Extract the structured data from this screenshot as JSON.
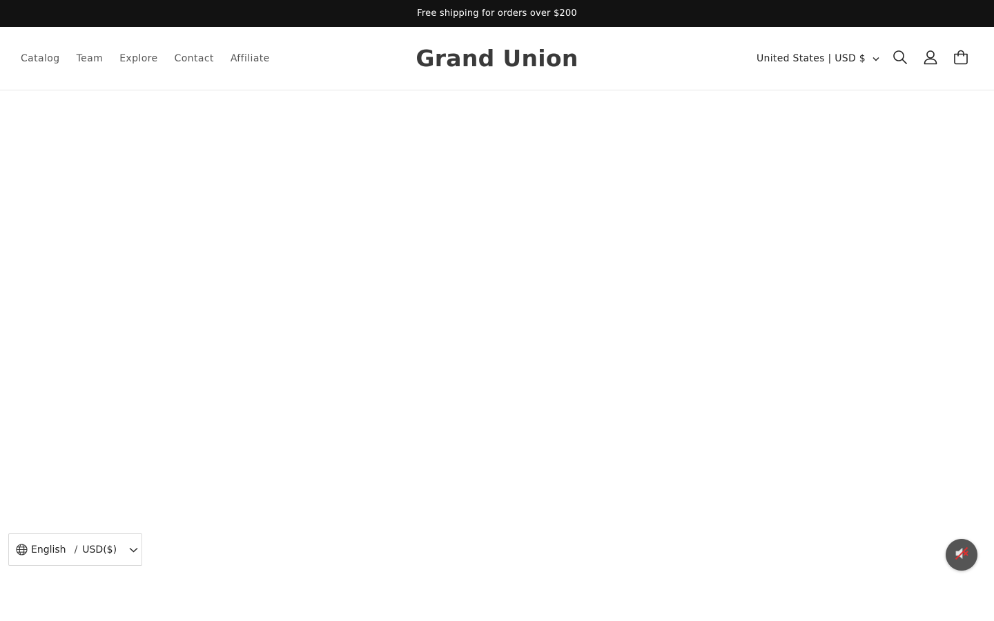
{
  "announcement": {
    "text": "Free shipping for orders over $200"
  },
  "nav": {
    "items": [
      {
        "label": "Catalog"
      },
      {
        "label": "Team"
      },
      {
        "label": "Explore"
      },
      {
        "label": "Contact"
      },
      {
        "label": "Affiliate"
      }
    ]
  },
  "brand": {
    "name": "Grand Union"
  },
  "header": {
    "country_selector": "United States | USD $",
    "icons": [
      "search-icon",
      "account-icon",
      "cart-icon"
    ]
  },
  "language_widget": {
    "language": "English",
    "separator": "/",
    "currency": "USD($)",
    "icons": [
      "globe-icon",
      "chevron-down-icon"
    ]
  },
  "mute_button": {
    "icon": "speaker-muted-icon"
  },
  "colors": {
    "announcement_bg": "#121212",
    "announcement_text": "#ffffff",
    "brand_text": "#3a3a3a",
    "nav_text": "#555555",
    "mute_bg": "#555555"
  }
}
